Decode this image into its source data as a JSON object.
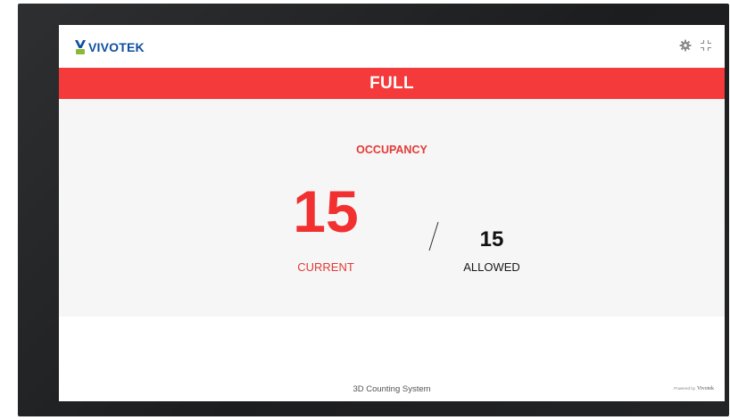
{
  "header": {
    "logo_text": "VIVOTEK",
    "icons": [
      "gear-icon",
      "exit-fullscreen-icon"
    ]
  },
  "banner": {
    "status": "FULL",
    "color": "#f43a3a"
  },
  "occupancy": {
    "title": "OCCUPANCY",
    "current_value": "15",
    "current_label": "CURRENT",
    "separator": "/",
    "allowed_value": "15",
    "allowed_label": "ALLOWED"
  },
  "footer": {
    "system_name": "3D Counting System",
    "powered_by_prefix": "Powered by",
    "powered_by_brand": "Vivotek"
  },
  "colors": {
    "accent_red": "#e33a36",
    "current_number": "#f2302f",
    "brand_blue": "#0d4f9e",
    "panel_bg": "#f6f6f6",
    "monitor_bezel": "#232426"
  }
}
